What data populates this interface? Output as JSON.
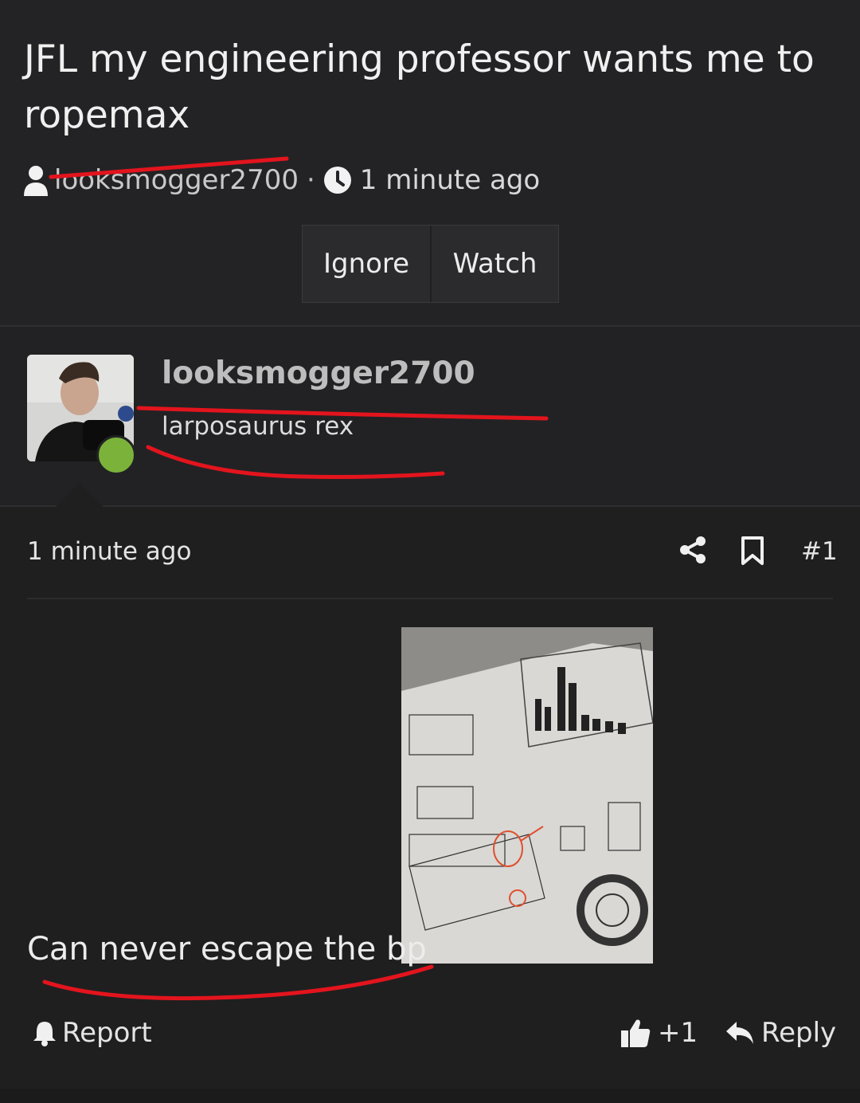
{
  "thread": {
    "title": "JFL my engineering professor wants me to ropemax",
    "author": "looksmogger2700",
    "separator": "·",
    "time": "1 minute ago",
    "buttons": {
      "ignore": "Ignore",
      "watch": "Watch"
    }
  },
  "post_author": {
    "username": "looksmogger2700",
    "user_title": "larposaurus rex",
    "online": true
  },
  "post": {
    "time": "1 minute ago",
    "number": "#1",
    "text": "Can never escape the bp",
    "actions": {
      "report": "Report",
      "like_count": "+1",
      "reply": "Reply"
    }
  },
  "icons": [
    "user-icon",
    "clock-icon",
    "share-icon",
    "bookmark-icon",
    "bell-icon",
    "thumbs-up-icon",
    "reply-icon"
  ],
  "colors": {
    "background": "#232325",
    "online": "#7bb33a",
    "redline": "#e3141d"
  }
}
